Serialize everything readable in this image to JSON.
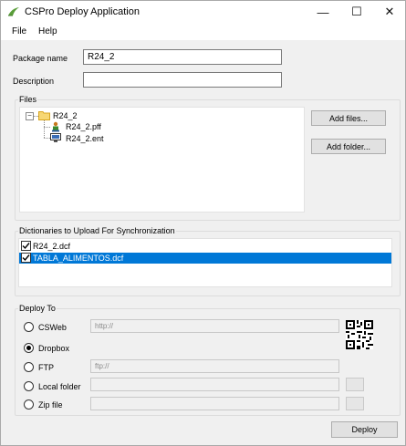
{
  "window": {
    "title": "CSPro Deploy Application",
    "minimize_glyph": "—",
    "maximize_glyph": "☐",
    "close_glyph": "✕"
  },
  "menu": {
    "file": "File",
    "help": "Help"
  },
  "form": {
    "package_name_label": "Package name",
    "package_name_value": "R24_2",
    "description_label": "Description",
    "description_value": ""
  },
  "files": {
    "group_title": "Files",
    "root": "R24_2",
    "children": [
      "R24_2.pff",
      "R24_2.ent"
    ],
    "add_files_button": "Add files...",
    "add_folder_button": "Add folder..."
  },
  "dictionaries": {
    "group_title": "Dictionaries to Upload For Synchronization",
    "items": [
      {
        "label": "R24_2.dcf",
        "checked": true,
        "selected": false
      },
      {
        "label": "TABLA_ALIMENTOS.dcf",
        "checked": true,
        "selected": true
      }
    ]
  },
  "deploy_to": {
    "group_title": "Deploy To",
    "options": [
      {
        "label": "CSWeb",
        "selected": false,
        "field_value": "http://"
      },
      {
        "label": "Dropbox",
        "selected": true
      },
      {
        "label": "FTP",
        "selected": false,
        "field_value": "ftp://"
      },
      {
        "label": "Local folder",
        "selected": false,
        "field_value": ""
      },
      {
        "label": "Zip file",
        "selected": false,
        "field_value": ""
      }
    ]
  },
  "deploy_button": "Deploy",
  "colors": {
    "selection": "#0078d7",
    "folder": "#f7d774",
    "window_bg": "#f0f0f0"
  },
  "icons": [
    "csp-logo-icon",
    "folder-icon",
    "pff-file-icon",
    "ent-file-icon",
    "qr-code-icon"
  ]
}
